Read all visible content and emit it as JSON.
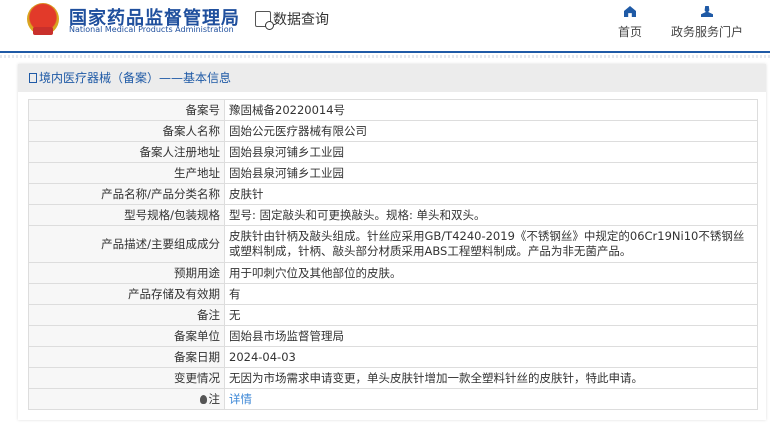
{
  "header": {
    "logo_cn": "国家药品监督管理局",
    "logo_en": "National Medical Products Administration",
    "data_query": "数据查询",
    "nav": [
      {
        "label": "首页",
        "icon": "home-icon"
      },
      {
        "label": "政务服务门户",
        "icon": "user-icon"
      }
    ],
    "accent": "#1f5aa6"
  },
  "panel": {
    "title": "境内医疗器械（备案）——基本信息"
  },
  "rows": [
    {
      "label": "备案号",
      "value": "豫固械备20220014号"
    },
    {
      "label": "备案人名称",
      "value": "固始公元医疗器械有限公司"
    },
    {
      "label": "备案人注册地址",
      "value": "固始县泉河铺乡工业园"
    },
    {
      "label": "生产地址",
      "value": "固始县泉河铺乡工业园"
    },
    {
      "label": "产品名称/产品分类名称",
      "value": "皮肤针"
    },
    {
      "label": "型号规格/包装规格",
      "value": "型号: 固定敲头和可更换敲头。规格: 单头和双头。"
    },
    {
      "label": "产品描述/主要组成成分",
      "value": "皮肤针由针柄及敲头组成。针丝应采用GB/T4240-2019《不锈钢丝》中规定的06Cr19Ni10不锈钢丝或塑料制成，针柄、敲头部分材质采用ABS工程塑料制成。产品为非无菌产品。"
    },
    {
      "label": "预期用途",
      "value": "用于叩刺穴位及其他部位的皮肤。"
    },
    {
      "label": "产品存储及有效期",
      "value": "有"
    },
    {
      "label": "备注",
      "value": "无"
    },
    {
      "label": "备案单位",
      "value": "固始县市场监督管理局"
    },
    {
      "label": "备案日期",
      "value": "2024-04-03"
    },
    {
      "label": "变更情况",
      "value": "无因为市场需求申请变更，单头皮肤针增加一款全塑料针丝的皮肤针，特此申请。"
    },
    {
      "label": "注",
      "value": "详情"
    }
  ]
}
